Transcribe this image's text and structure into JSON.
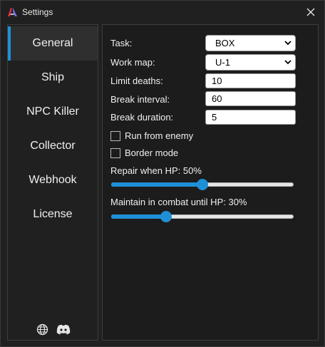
{
  "window": {
    "title": "Settings"
  },
  "sidebar": {
    "items": [
      {
        "label": "General",
        "active": true
      },
      {
        "label": "Ship",
        "active": false
      },
      {
        "label": "NPC Killer",
        "active": false
      },
      {
        "label": "Collector",
        "active": false
      },
      {
        "label": "Webhook",
        "active": false
      },
      {
        "label": "License",
        "active": false
      }
    ],
    "footer_icons": [
      "globe-icon",
      "discord-icon"
    ]
  },
  "general": {
    "task": {
      "label": "Task:",
      "value": "BOX"
    },
    "work_map": {
      "label": "Work map:",
      "value": "U-1"
    },
    "limit_deaths": {
      "label": "Limit deaths:",
      "value": "10"
    },
    "break_interval": {
      "label": "Break interval:",
      "value": "60"
    },
    "break_duration": {
      "label": "Break duration:",
      "value": "5"
    },
    "run_from_enemy": {
      "label": "Run from enemy",
      "checked": false
    },
    "border_mode": {
      "label": "Border mode",
      "checked": false
    },
    "repair_hp": {
      "label": "Repair when HP: 50%",
      "value": 50
    },
    "combat_hp": {
      "label": "Maintain in combat until HP: 30%",
      "value": 30
    }
  },
  "colors": {
    "accent": "#1f8fd6",
    "background": "#202020"
  }
}
